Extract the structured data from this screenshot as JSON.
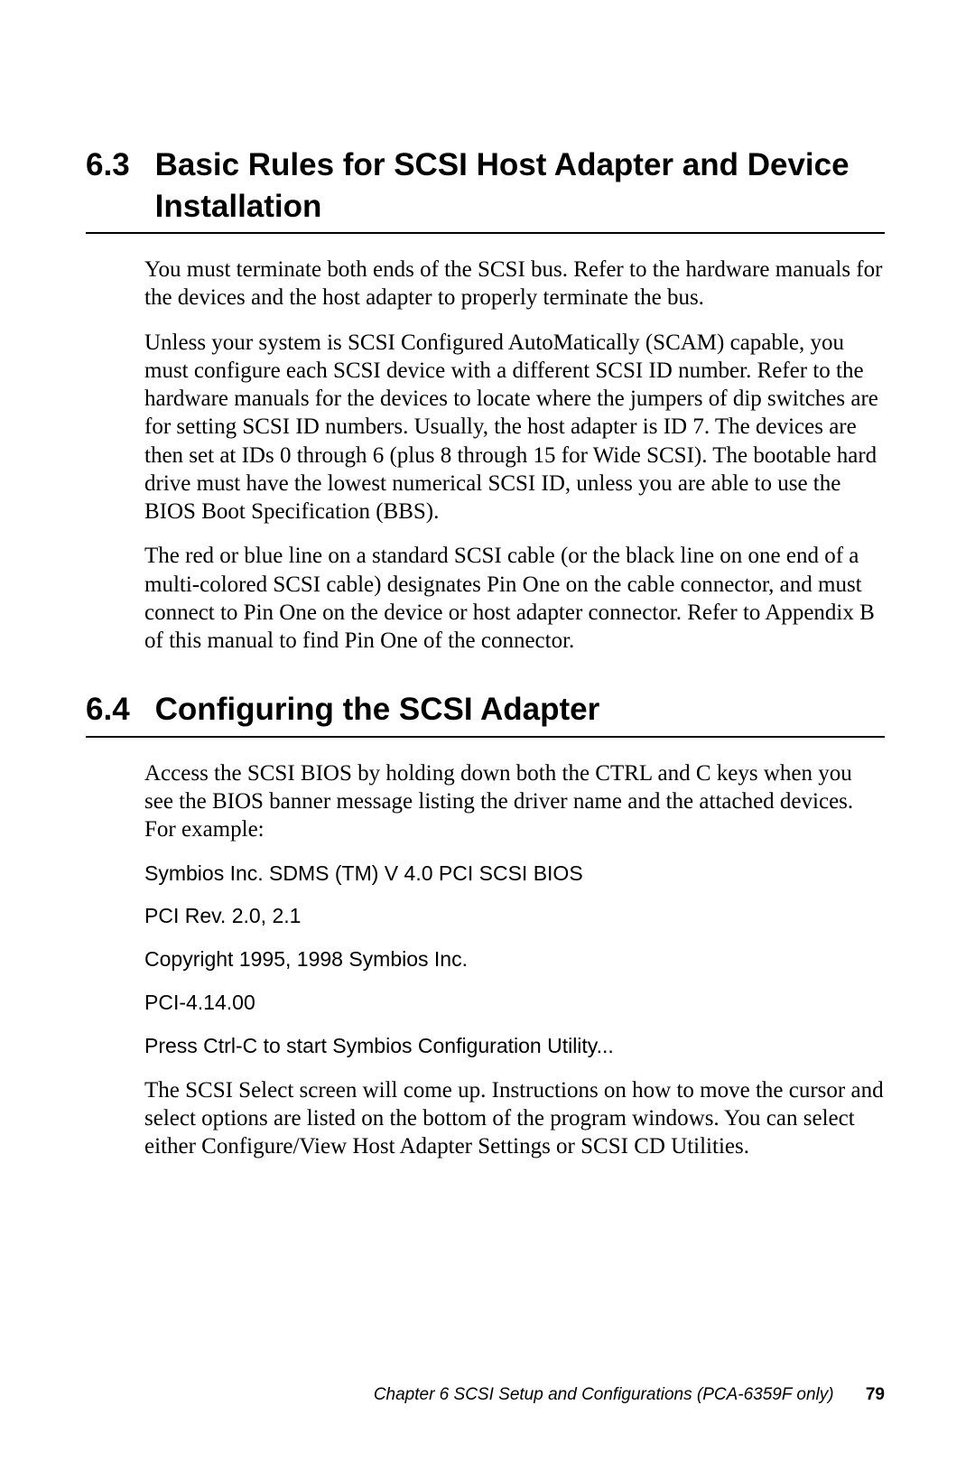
{
  "section1": {
    "number": "6.3",
    "title": "Basic Rules for SCSI Host Adapter and Device Installation",
    "para1": "You must terminate both ends of the SCSI bus. Refer to the hardware manuals for the devices and the host adapter to properly terminate the bus.",
    "para2": "Unless your system is SCSI Configured AutoMatically (SCAM) capable, you must configure each SCSI device with a different SCSI ID number. Refer to the hardware manuals for the devices to locate where the jumpers of dip switches are for setting SCSI ID numbers. Usually, the host adapter is ID 7. The devices are then set at IDs 0 through 6 (plus 8 through 15 for Wide SCSI). The bootable hard drive must have the lowest numerical SCSI ID, unless you are able to use the BIOS Boot Specification (BBS).",
    "para3": "The red or blue line on a standard SCSI cable (or the black line on one end of a multi-colored SCSI cable) designates Pin One on the cable connector, and must connect to Pin One on the device or host adapter connector. Refer to Appendix B of this manual to find Pin One of the connector."
  },
  "section2": {
    "number": "6.4",
    "title": "Configuring the SCSI Adapter",
    "para1": "Access the SCSI BIOS by holding down both the CTRL and C keys when you see the BIOS banner message listing the driver name and the attached devices. For example:",
    "line1": "Symbios Inc. SDMS (TM) V 4.0 PCI SCSI BIOS",
    "line2": "PCI Rev. 2.0, 2.1",
    "line3": "Copyright 1995, 1998 Symbios Inc.",
    "line4": "PCI-4.14.00",
    "line5": "Press Ctrl-C to start Symbios Configuration Utility...",
    "para2": "The SCSI Select screen will come up. Instructions on how to move the cursor and select options are listed on the bottom of the program windows. You can select either Configure/View Host Adapter Settings or SCSI CD Utilities."
  },
  "footer": {
    "text": "Chapter 6  SCSI Setup and Configurations (PCA-6359F only)",
    "page": "79"
  }
}
